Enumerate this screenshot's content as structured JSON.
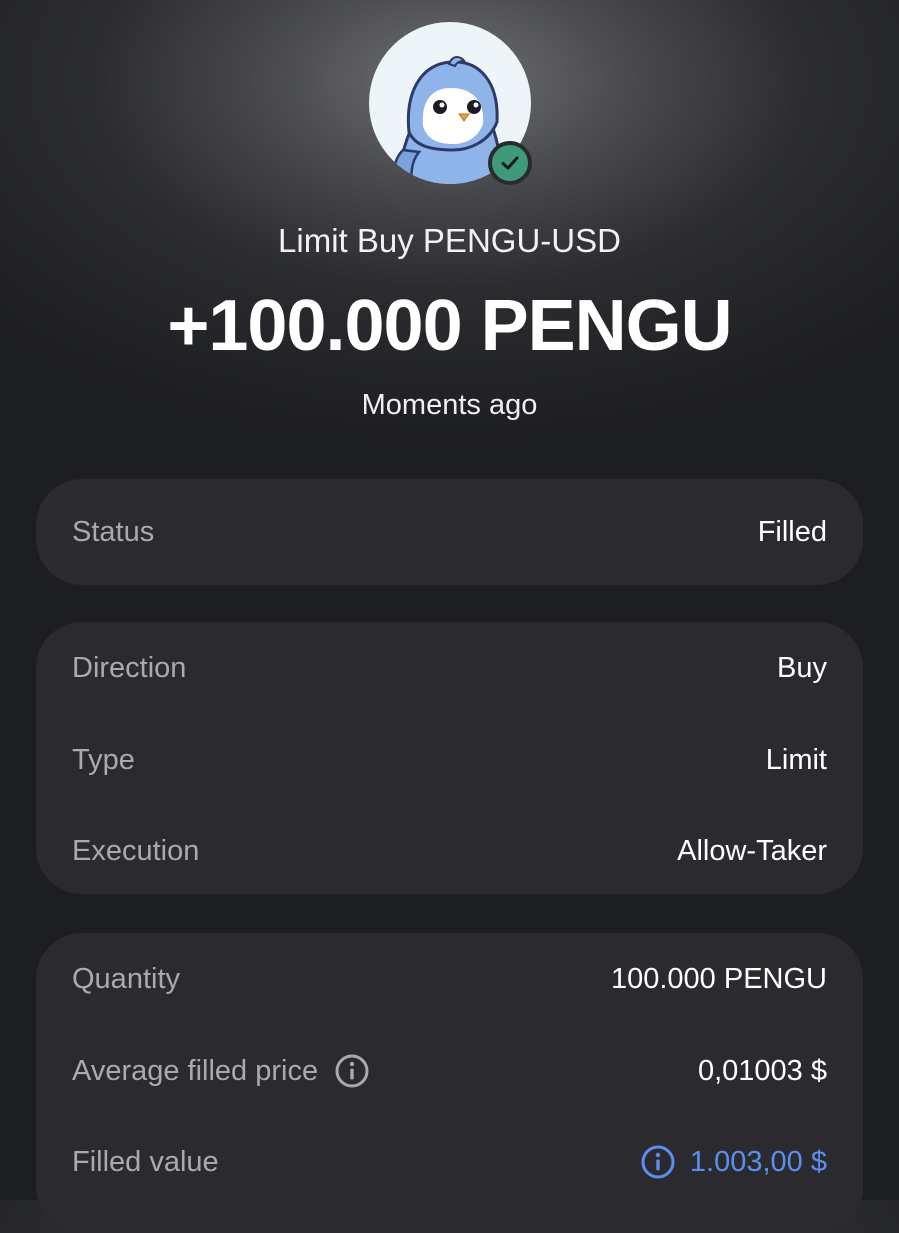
{
  "header": {
    "avatar": "pengu-penguin-avatar",
    "badge_icon": "check-icon",
    "subtitle": "Limit Buy PENGU-USD",
    "amount": "+100.000 PENGU",
    "time": "Moments ago"
  },
  "status_card": {
    "rows": [
      {
        "label": "Status",
        "value": "Filled"
      }
    ]
  },
  "order_card": {
    "rows": [
      {
        "label": "Direction",
        "value": "Buy"
      },
      {
        "label": "Type",
        "value": "Limit"
      },
      {
        "label": "Execution",
        "value": "Allow-Taker"
      }
    ]
  },
  "fill_card": {
    "rows": [
      {
        "label": "Quantity",
        "value": "100.000 PENGU"
      },
      {
        "label": "Average filled price",
        "value": "0,01003 $",
        "label_icon": "info-icon"
      },
      {
        "label": "Filled value",
        "value": "1.003,00 $",
        "value_icon": "info-icon"
      }
    ]
  },
  "colors": {
    "accent": "#5a8ff0",
    "badge": "#3f9a7a",
    "card": "#2b2b2f",
    "label": "#a9a9ae"
  }
}
